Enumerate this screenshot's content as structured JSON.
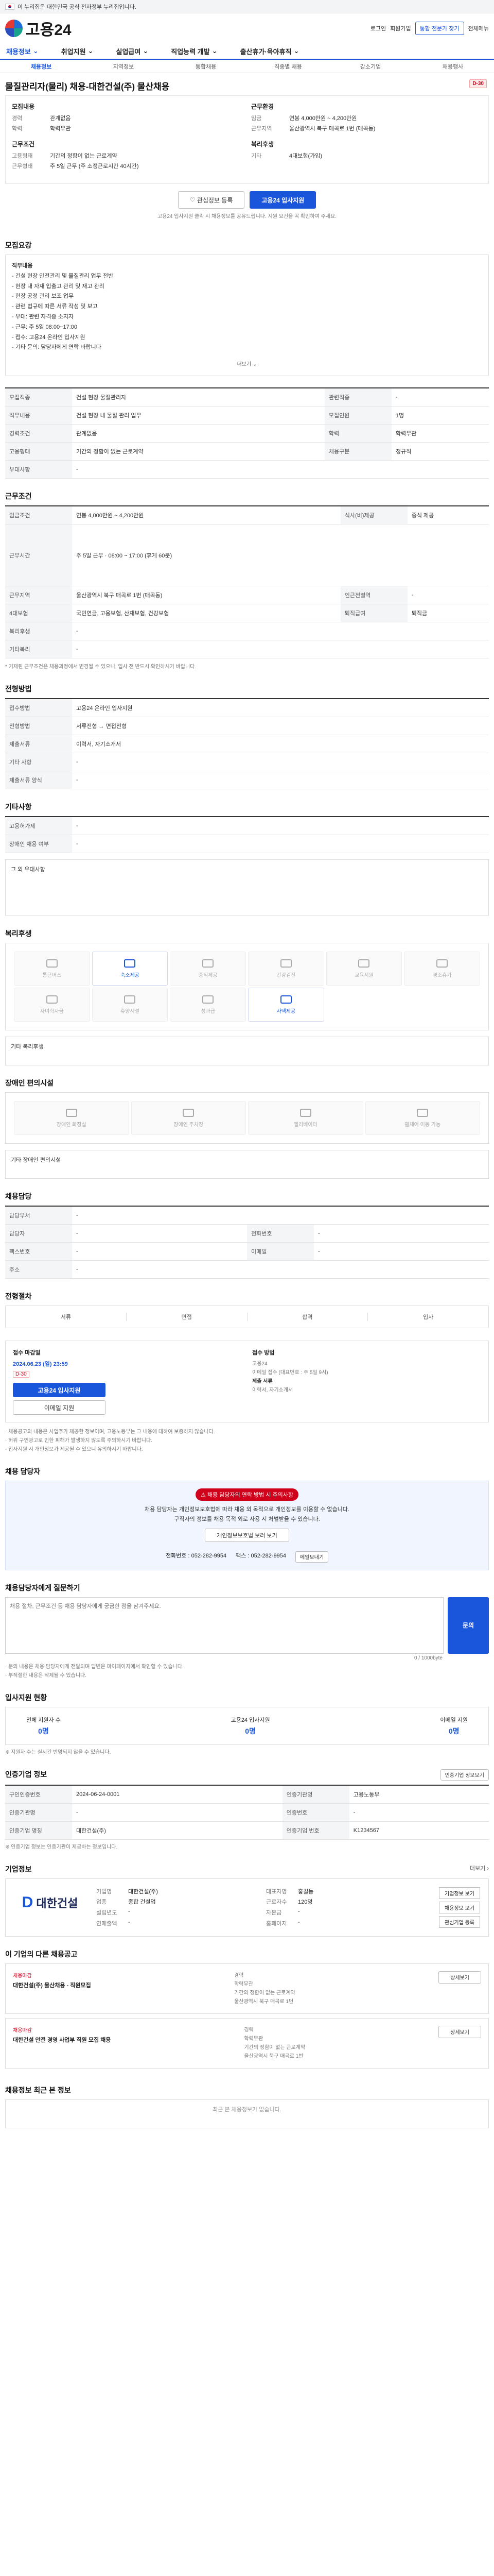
{
  "topbar": {
    "text": "이 누리집은 대한민국 공식 전자정부 누리집입니다."
  },
  "header": {
    "logo_text": "고용24",
    "login": "로그인",
    "signup": "회원가입",
    "mypage": "통합 전문가 찾기",
    "search_btn": "전체메뉴"
  },
  "gnb": [
    "채용정보",
    "취업지원",
    "실업급여",
    "직업능력 개발",
    "출산휴가·육아휴직"
  ],
  "subnav": [
    "채용정보",
    "지역정보",
    "통합채용",
    "직종별 채용",
    "강소기업",
    "채용행사"
  ],
  "posting": {
    "title": "물질관리자(물리) 채용-대한건설(주) 물산채용",
    "badge": "D-30",
    "left_groups": [
      {
        "heading": "모집내용",
        "rows": [
          [
            "경력",
            "관계없음"
          ],
          [
            "학력",
            "학력무관"
          ]
        ]
      },
      {
        "heading": "근무조건",
        "rows": [
          [
            "고용형태",
            "기간의 정함이 없는 근로계약"
          ],
          [
            "근무형태",
            "주 5일 근무 (주 소정근로시간 40시간)"
          ]
        ]
      }
    ],
    "right_groups": [
      {
        "heading": "근무환경",
        "rows": [
          [
            "임금",
            "연봉 4,000만원 ~ 4,200만원"
          ],
          [
            "근무지역",
            "울산광역시 북구 매곡로 1번 (매곡동)"
          ]
        ]
      },
      {
        "heading": "복리후생",
        "rows": [
          [
            "기타",
            "4대보험(가입)"
          ]
        ]
      }
    ],
    "btn_save": "관심정보 등록",
    "btn_apply": "고용24 입사지원",
    "note": "고용24 입사지원 클릭 시 채용정보를 공유드립니다. 지원 요건을 꼭 확인하여 주세요."
  },
  "detail": {
    "section": "모집요강",
    "duties_title": "직무내용",
    "duties": [
      "- 건설 현장 안전관리 및 물질관리 업무 전반",
      "- 현장 내 자재 입출고 관리 및 재고 관리",
      "- 현장 공정 관리 보조 업무",
      "- 관련 법규에 따른 서류 작성 및 보고",
      "- 우대: 관련 자격증 소지자",
      "- 근무: 주 5일 08:00~17:00",
      "- 접수: 고용24 온라인 입사지원",
      "- 기타 문의: 담당자에게 연락 바랍니다"
    ],
    "more": "더보기"
  },
  "cond_table": [
    [
      "모집직종",
      "건설 현장 물질관리자",
      "관련직종",
      "-"
    ],
    [
      "직무내용",
      "건설 현장 내 물질 관리 업무",
      "모집인원",
      "1명"
    ],
    [
      "경력조건",
      "관계없음",
      "학력",
      "학력무관"
    ],
    [
      "고용형태",
      "기간의 정함이 없는 근로계약",
      "채용구분",
      "정규직"
    ],
    [
      "우대사항",
      "-",
      "",
      ""
    ]
  ],
  "work": {
    "section": "근무조건",
    "table": [
      [
        "임금조건",
        "연봉 4,000만원 ~ 4,200만원",
        "식사(비)제공",
        "중식 제공"
      ],
      [
        "근무시간",
        "주 5일 근무 · 08:00 ~ 17:00 (휴게 60분)",
        "",
        ""
      ],
      [
        "근무지역",
        "울산광역시 북구 매곡로 1번 (매곡동)",
        "인근전철역",
        "-"
      ],
      [
        "4대보험",
        "국민연금, 고용보험, 산재보험, 건강보험",
        "퇴직급여",
        "퇴직금"
      ],
      [
        "복리후생",
        "-",
        "",
        ""
      ],
      [
        "기타복리",
        "-",
        "",
        ""
      ]
    ],
    "footnote": "* 기재된 근무조건은 채용과정에서 변경될 수 있으니, 입사 전 반드시 확인하시기 바랍니다."
  },
  "apply_method": {
    "section": "전형방법",
    "table": [
      [
        "접수방법",
        "고용24 온라인 입사지원"
      ],
      [
        "전형방법",
        "서류전형 → 면접전형"
      ],
      [
        "제출서류",
        "이력서, 자기소개서"
      ],
      [
        "기타 사항",
        "-"
      ],
      [
        "제출서류 양식",
        "-"
      ]
    ]
  },
  "misc": {
    "section": "기타사항",
    "table": [
      [
        "고용허가제",
        "-"
      ],
      [
        "장애인 채용 여부",
        "-"
      ]
    ],
    "extra_title": "그 외 우대사항"
  },
  "welfare": {
    "section": "복리후생",
    "items": [
      {
        "label": "통근버스",
        "on": false
      },
      {
        "label": "숙소제공",
        "on": true
      },
      {
        "label": "중식제공",
        "on": false
      },
      {
        "label": "건강검진",
        "on": false
      },
      {
        "label": "교육지원",
        "on": false
      },
      {
        "label": "경조휴가",
        "on": false
      },
      {
        "label": "자녀학자금",
        "on": false
      },
      {
        "label": "휴양시설",
        "on": false
      },
      {
        "label": "성과급",
        "on": false
      },
      {
        "label": "사택제공",
        "on": true
      }
    ],
    "extra_title": "기타 복리후생"
  },
  "disability": {
    "section": "장애인 편의시설",
    "items": [
      "장애인 화장실",
      "장애인 주차장",
      "엘리베이터",
      "휠체어 이동 가능"
    ],
    "extra_title": "기타 장애인 편의시설"
  },
  "hr": {
    "section": "채용담당",
    "table": [
      [
        "담당부서",
        "-",
        "",
        ""
      ],
      [
        "담당자",
        "-",
        "전화번호",
        "-"
      ],
      [
        "팩스번호",
        "-",
        "이메일",
        "-"
      ],
      [
        "주소",
        "-",
        "",
        ""
      ]
    ]
  },
  "selection": {
    "section": "전형절차",
    "steps": [
      "서류",
      "면접",
      "합격",
      "입사"
    ]
  },
  "apply_block": {
    "left_title": "접수 마감일",
    "left_date": "2024.06.23 (일) 23:59",
    "left_badge": "D-30",
    "left_btn": "고용24 입사지원",
    "left_btn2": "이메일 지원",
    "right_title": "접수 방법",
    "right_lines": [
      "고용24",
      "이메일 접수 (대표번호 : 주 5일 9시)",
      "제출 서류",
      "이력서, 자기소개서"
    ],
    "notes": [
      "· 채용공고의 내용은 사업주가 제공한 정보이며, 고용노동부는 그 내용에 대하여 보증하지 않습니다.",
      "· 허위 구인광고로 인한 피해가 발생하지 않도록 주의하시기 바랍니다.",
      "· 입사지원 시 개인정보가 제공될 수 있으니 유의하시기 바랍니다."
    ]
  },
  "contact": {
    "section": "채용 담당자",
    "warn_banner": "채용 담당자의 연락 방법 시 주의사항",
    "warn_lines": [
      "채용 담당자는 개인정보보호법에 따라 채용 외 목적으로 개인정보를 이용할 수 없습니다.",
      "구직자의 정보를 채용 목적 외로 사용 시 처벌받을 수 있습니다."
    ],
    "warn_btn": "개인정보보호법 보러 보기",
    "phone_label": "전화번호",
    "phone": "052-282-9954",
    "fax_label": "팩스",
    "fax": "052-282-9954",
    "email_btn": "메일보내기"
  },
  "qa": {
    "section": "채용담당자에게 질문하기",
    "placeholder": "채용 절차, 근무조건 등 채용 담당자에게 궁금한 점을 남겨주세요.",
    "btn": "문의",
    "counter": "0 / 1000byte",
    "notes": [
      "· 문의 내용은 채용 담당자에게 전달되며 답변은 마이페이지에서 확인할 수 있습니다.",
      "· 부적절한 내용은 삭제될 수 있습니다."
    ]
  },
  "stats": {
    "section": "입사지원 현황",
    "items": [
      {
        "label": "전체 지원자 수",
        "value": "0명"
      },
      {
        "label": "고용24 입사지원",
        "value": "0명"
      },
      {
        "label": "이메일 지원",
        "value": "0명"
      }
    ],
    "note": "※ 지원자 수는 실시간 반영되지 않을 수 있습니다."
  },
  "company_info_meta": {
    "section": "인증기업 정보",
    "btn": "인증기업 정보보기",
    "table": [
      [
        "구인인증번호",
        "2024-06-24-0001",
        "인증기관명",
        "고용노동부"
      ],
      [
        "인증기관명",
        "-",
        "인증번호",
        "-"
      ],
      [
        "인증기업 명칭",
        "대한건설(주)",
        "인증기업 번호",
        "K1234567"
      ]
    ],
    "note": "※ 인증기업 정보는 인증기관이 제공하는 정보입니다."
  },
  "company": {
    "section": "기업정보",
    "more": "더보기",
    "logo_letter": "D",
    "logo_text": "대한건설",
    "rows": [
      [
        "기업명",
        "대한건설(주)",
        "대표자명",
        "홍길동"
      ],
      [
        "업종",
        "종합 건설업",
        "근로자수",
        "120명"
      ],
      [
        "설립년도",
        "-",
        "자본금",
        "-"
      ],
      [
        "연매출액",
        "-",
        "홈페이지",
        "-"
      ]
    ],
    "btns": [
      "기업정보 보기",
      "채용정보 보기",
      "관심기업 등록"
    ]
  },
  "others": {
    "section": "이 기업의 다른 채용공고",
    "items": [
      {
        "badge": "채용마감",
        "title": "대한건설(주) 물산채용 - 직원모집",
        "meta": [
          "경력",
          "학력무관",
          "기간의 정함이 없는 근로계약",
          "울산광역시 북구 매곡로 1번"
        ],
        "btn": "상세보기"
      },
      {
        "badge": "채용마감",
        "title": "대한건설 안전 경영 사업부 직원 모집 채용",
        "meta": [
          "경력",
          "학력무관",
          "기간의 정함이 없는 근로계약",
          "울산광역시 북구 매곡로 1번"
        ],
        "btn": "상세보기"
      }
    ]
  },
  "recent": {
    "section": "채용정보 최근 본 정보",
    "empty": "최근 본 채용정보가 없습니다."
  }
}
